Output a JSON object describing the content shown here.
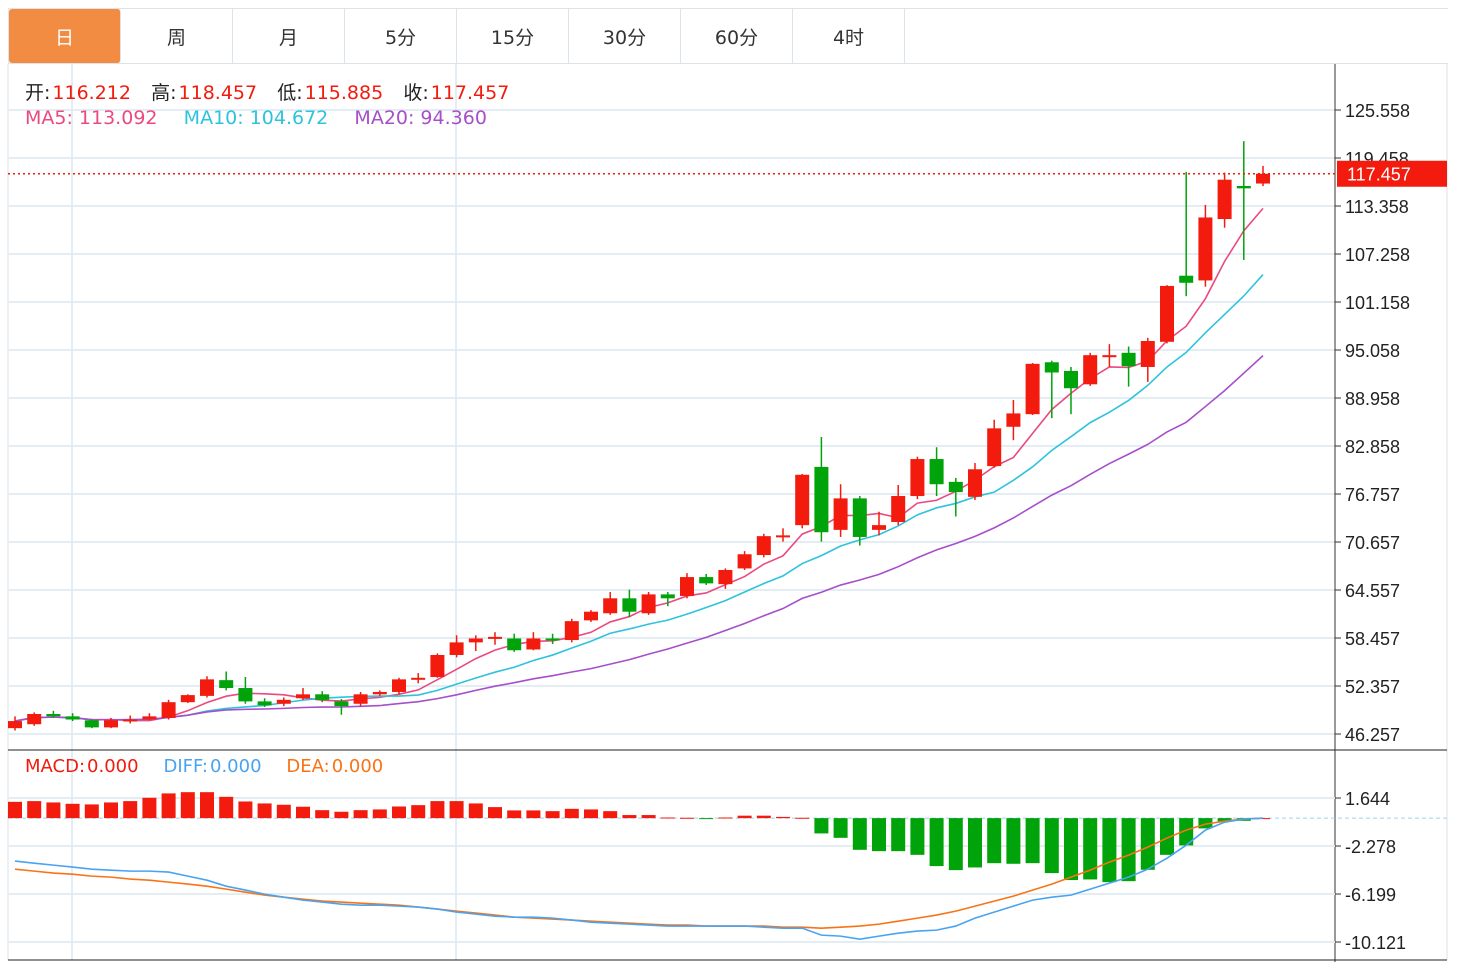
{
  "tabs": [
    {
      "label": "日",
      "active": true
    },
    {
      "label": "周",
      "active": false
    },
    {
      "label": "月",
      "active": false
    },
    {
      "label": "5分",
      "active": false
    },
    {
      "label": "15分",
      "active": false
    },
    {
      "label": "30分",
      "active": false
    },
    {
      "label": "60分",
      "active": false
    },
    {
      "label": "4时",
      "active": false
    }
  ],
  "ohlc_legend": {
    "open_label": "开:",
    "open": "116.212",
    "high_label": "高:",
    "high": "118.457",
    "low_label": "低:",
    "low": "115.885",
    "close_label": "收:",
    "close": "117.457"
  },
  "ma_legend": {
    "ma5": "MA5: 113.092",
    "ma10": "MA10: 104.672",
    "ma20": "MA20: 94.360"
  },
  "macd_legend": {
    "macd_label": "MACD:",
    "macd": "0.000",
    "diff_label": "DIFF:",
    "diff": "0.000",
    "dea_label": "DEA:",
    "dea": "0.000"
  },
  "colors": {
    "up": "#f21b0d",
    "down": "#00a30a",
    "ma5": "#ea4a80",
    "ma10": "#2ec3dd",
    "ma20": "#a64fc9",
    "diff": "#4aa3f0",
    "dea": "#f97316",
    "active_tab": "#f28c42"
  },
  "chart_data": [
    {
      "type": "candlestick",
      "price_ticks": [
        "125.558",
        "119.458",
        "113.358",
        "107.258",
        "101.158",
        "95.058",
        "88.958",
        "82.858",
        "76.757",
        "70.657",
        "64.557",
        "58.457",
        "52.357",
        "46.257"
      ],
      "ylim": [
        46.257,
        125.558
      ],
      "last_price": "117.457",
      "grid": true,
      "ma_periods": [
        5,
        10,
        20
      ],
      "candles_ohlc": [
        [
          47.0,
          48.5,
          46.7,
          47.9
        ],
        [
          47.5,
          49.0,
          47.3,
          48.8
        ],
        [
          48.8,
          49.2,
          48.3,
          48.5
        ],
        [
          48.5,
          48.9,
          47.9,
          48.1
        ],
        [
          48.0,
          48.1,
          47.0,
          47.1
        ],
        [
          47.1,
          48.3,
          47.0,
          48.0
        ],
        [
          48.0,
          48.6,
          47.6,
          48.1
        ],
        [
          48.1,
          48.9,
          48.0,
          48.5
        ],
        [
          48.3,
          50.6,
          48.1,
          50.3
        ],
        [
          50.3,
          51.3,
          50.2,
          51.2
        ],
        [
          51.1,
          53.6,
          50.9,
          53.2
        ],
        [
          53.1,
          54.2,
          51.8,
          52.1
        ],
        [
          52.1,
          53.5,
          50.1,
          50.4
        ],
        [
          50.4,
          50.8,
          49.7,
          49.9
        ],
        [
          50.1,
          50.9,
          49.8,
          50.6
        ],
        [
          50.8,
          52.1,
          50.6,
          51.3
        ],
        [
          51.3,
          51.7,
          50.3,
          50.6
        ],
        [
          50.4,
          50.7,
          48.7,
          49.8
        ],
        [
          50.1,
          51.6,
          49.8,
          51.3
        ],
        [
          51.3,
          51.8,
          51.1,
          51.6
        ],
        [
          51.6,
          53.4,
          51.3,
          53.2
        ],
        [
          53.2,
          54.0,
          52.7,
          53.4
        ],
        [
          53.5,
          56.5,
          53.4,
          56.3
        ],
        [
          56.3,
          58.8,
          56.0,
          57.9
        ],
        [
          57.9,
          58.8,
          56.8,
          58.4
        ],
        [
          58.4,
          59.2,
          57.6,
          58.6
        ],
        [
          58.4,
          59.0,
          56.7,
          56.9
        ],
        [
          57.0,
          59.2,
          56.9,
          58.4
        ],
        [
          58.4,
          59.0,
          57.7,
          58.2
        ],
        [
          58.2,
          60.9,
          57.9,
          60.6
        ],
        [
          60.7,
          62.0,
          60.5,
          61.8
        ],
        [
          61.6,
          64.3,
          61.4,
          63.5
        ],
        [
          63.5,
          64.6,
          61.1,
          61.8
        ],
        [
          61.6,
          64.3,
          61.4,
          64.0
        ],
        [
          64.0,
          64.3,
          62.5,
          63.5
        ],
        [
          63.8,
          66.7,
          63.5,
          66.2
        ],
        [
          66.2,
          66.6,
          65.2,
          65.4
        ],
        [
          65.3,
          67.3,
          64.7,
          67.1
        ],
        [
          67.3,
          69.5,
          67.1,
          69.1
        ],
        [
          69.0,
          71.7,
          68.7,
          71.4
        ],
        [
          71.4,
          72.4,
          70.7,
          71.5
        ],
        [
          72.8,
          79.3,
          72.4,
          79.2
        ],
        [
          80.2,
          84.0,
          70.7,
          71.9
        ],
        [
          72.2,
          78.0,
          71.3,
          76.2
        ],
        [
          76.2,
          76.5,
          70.2,
          71.3
        ],
        [
          72.2,
          74.5,
          71.5,
          72.8
        ],
        [
          73.2,
          77.9,
          72.8,
          76.5
        ],
        [
          76.5,
          81.5,
          76.1,
          81.2
        ],
        [
          81.2,
          82.7,
          76.5,
          78.0
        ],
        [
          78.3,
          78.8,
          73.9,
          77.0
        ],
        [
          76.4,
          80.7,
          76.0,
          79.9
        ],
        [
          80.3,
          86.2,
          80.1,
          85.1
        ],
        [
          85.3,
          88.7,
          83.6,
          87.0
        ],
        [
          86.9,
          93.4,
          86.8,
          93.3
        ],
        [
          93.5,
          93.7,
          86.4,
          92.2
        ],
        [
          92.4,
          92.9,
          86.9,
          90.2
        ],
        [
          90.7,
          94.7,
          90.5,
          94.4
        ],
        [
          94.4,
          95.8,
          92.9,
          94.4
        ],
        [
          94.7,
          95.5,
          90.4,
          93.0
        ],
        [
          92.9,
          96.6,
          91.0,
          96.2
        ],
        [
          96.1,
          103.3,
          95.9,
          103.2
        ],
        [
          104.5,
          117.7,
          101.9,
          103.6
        ],
        [
          103.9,
          113.5,
          103.1,
          111.9
        ],
        [
          111.7,
          117.6,
          110.6,
          116.7
        ],
        [
          115.9,
          121.6,
          106.5,
          115.6
        ],
        [
          116.212,
          118.457,
          115.885,
          117.457
        ]
      ]
    },
    {
      "type": "macd",
      "ticks": [
        "1.644",
        "-2.278",
        "-6.199",
        "-10.121"
      ],
      "ylim": [
        -10.6,
        2.4
      ],
      "histogram": [
        1.33,
        1.39,
        1.28,
        1.17,
        1.12,
        1.28,
        1.39,
        1.66,
        2.02,
        2.12,
        2.12,
        1.74,
        1.36,
        1.2,
        1.09,
        0.93,
        0.65,
        0.52,
        0.65,
        0.71,
        0.95,
        1.06,
        1.39,
        1.39,
        1.2,
        0.9,
        0.63,
        0.63,
        0.57,
        0.76,
        0.71,
        0.57,
        0.25,
        0.25,
        0.05,
        0.03,
        -0.02,
        0.05,
        0.2,
        0.2,
        0.1,
        0.03,
        -1.25,
        -1.61,
        -2.59,
        -2.7,
        -2.7,
        -3.0,
        -3.92,
        -4.25,
        -4.03,
        -3.68,
        -3.73,
        -3.68,
        -4.49,
        -5.06,
        -5.01,
        -5.23,
        -5.15,
        -4.22,
        -3.0,
        -2.23,
        -0.84,
        -0.27,
        -0.22,
        0
      ],
      "diff": [
        -3.51,
        -3.68,
        -3.84,
        -4.0,
        -4.17,
        -4.25,
        -4.33,
        -4.33,
        -4.41,
        -4.74,
        -5.07,
        -5.56,
        -5.88,
        -6.21,
        -6.46,
        -6.7,
        -6.86,
        -7.03,
        -7.11,
        -7.11,
        -7.19,
        -7.27,
        -7.43,
        -7.68,
        -7.84,
        -8.01,
        -8.09,
        -8.09,
        -8.17,
        -8.33,
        -8.5,
        -8.58,
        -8.66,
        -8.74,
        -8.82,
        -8.82,
        -8.82,
        -8.82,
        -8.82,
        -8.91,
        -8.99,
        -8.99,
        -9.56,
        -9.64,
        -9.89,
        -9.64,
        -9.4,
        -9.23,
        -9.15,
        -8.82,
        -8.17,
        -7.68,
        -7.19,
        -6.7,
        -6.46,
        -6.29,
        -5.8,
        -5.31,
        -4.82,
        -4.17,
        -3.27,
        -2.21,
        -0.98,
        -0.33,
        -0.08,
        0
      ],
      "dea": [
        -4.17,
        -4.33,
        -4.49,
        -4.58,
        -4.74,
        -4.82,
        -4.98,
        -5.07,
        -5.23,
        -5.39,
        -5.56,
        -5.8,
        -6.05,
        -6.29,
        -6.46,
        -6.62,
        -6.78,
        -6.86,
        -6.95,
        -7.03,
        -7.11,
        -7.27,
        -7.43,
        -7.6,
        -7.76,
        -7.92,
        -8.09,
        -8.17,
        -8.25,
        -8.33,
        -8.42,
        -8.5,
        -8.58,
        -8.66,
        -8.74,
        -8.74,
        -8.82,
        -8.82,
        -8.82,
        -8.82,
        -8.91,
        -8.91,
        -8.99,
        -8.91,
        -8.82,
        -8.66,
        -8.42,
        -8.17,
        -7.92,
        -7.6,
        -7.19,
        -6.78,
        -6.37,
        -5.88,
        -5.39,
        -4.82,
        -4.25,
        -3.59,
        -3.02,
        -2.37,
        -1.63,
        -0.98,
        -0.49,
        -0.25,
        -0.08,
        0
      ]
    }
  ]
}
